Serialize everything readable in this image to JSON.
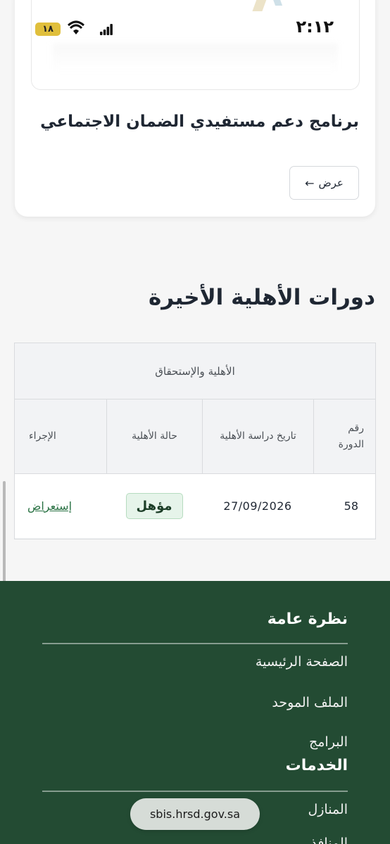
{
  "status_bar": {
    "time": "٢:١٢",
    "battery": "١٨"
  },
  "program_card": {
    "title": "برنامج دعم مستفيدي الضمان الاجتماعي",
    "view_label": "عرض",
    "view_arrow": "←"
  },
  "eligibility": {
    "section_title": "دورات الأهلية الأخيرة",
    "group_header": "الأهلية والإستحقاق",
    "columns": [
      "رقم الدورة",
      "تاريخ دراسة الأهلية",
      "حالة الأهلية",
      "الإجراء"
    ],
    "rows": [
      {
        "cycle": "58",
        "date": "27/09/2026",
        "status": "مؤهل",
        "action": "إستعراض"
      }
    ]
  },
  "footer": {
    "overview": "نظرة عامة",
    "nav": [
      "الصفحة الرئيسية",
      "الملف الموحد",
      "البرامج"
    ],
    "services": "الخدمات",
    "services_nav": [
      "المنازل",
      "المنافذ"
    ]
  },
  "browser": {
    "url": "sbis.hrsd.gov.sa"
  },
  "colors": {
    "footer_bg": "#234b33",
    "badge_bg": "#e6f4ea",
    "link": "#2a7244",
    "battery": "#e0bf3c"
  }
}
